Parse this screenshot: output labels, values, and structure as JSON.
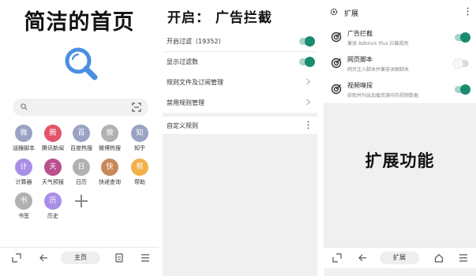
{
  "panel1": {
    "headline": "简洁的首页",
    "logo_icon": "magnifier-logo-icon",
    "search": {
      "placeholder": "",
      "search_icon": "search-icon",
      "scan_icon": "scan-icon"
    },
    "tiles": [
      {
        "glyph": "微",
        "label": "油猴脚本",
        "color": "#9aa3c4"
      },
      {
        "glyph": "腾",
        "label": "腾讯新闻",
        "color": "#e4536a"
      },
      {
        "glyph": "百",
        "label": "百度热搜",
        "color": "#9aa3c4"
      },
      {
        "glyph": "微",
        "label": "微博热搜",
        "color": "#b1b1b1"
      },
      {
        "glyph": "知",
        "label": "知乎",
        "color": "#9aa3c4"
      },
      {
        "glyph": "计",
        "label": "计算器",
        "color": "#a98ee6"
      },
      {
        "glyph": "天",
        "label": "天气预报",
        "color": "#b8508e"
      },
      {
        "glyph": "日",
        "label": "日历",
        "color": "#b1b1b1"
      },
      {
        "glyph": "快",
        "label": "快递查询",
        "color": "#c9885a"
      },
      {
        "glyph": "帮",
        "label": "帮助",
        "color": "#f0b04a"
      },
      {
        "glyph": "书",
        "label": "书签",
        "color": "#b1b1b1"
      },
      {
        "glyph": "历",
        "label": "历史",
        "color": "#a98ee6"
      },
      {
        "glyph": "+",
        "label": "",
        "color": ""
      }
    ],
    "bottombar": {
      "home_label": "主页"
    }
  },
  "panel2": {
    "title": "开启：  广告拦截",
    "rows": [
      {
        "label": "开启过滤（19352）",
        "control": "toggle-on"
      },
      {
        "label": "显示过滤数",
        "control": "toggle-on"
      },
      {
        "label": "规则文件及订阅管理",
        "control": "chevron"
      },
      {
        "label": "禁用规则管理",
        "control": "chevron"
      },
      {
        "label": "自定义规则",
        "control": "kebab"
      }
    ]
  },
  "panel3": {
    "header_title": "扩展",
    "extensions": [
      {
        "name": "广告拦截",
        "desc": "兼容 Adblock Plus 拦截规则",
        "enabled": true
      },
      {
        "name": "网页脚本",
        "desc": "网页注入脚本并兼容油猴脚本",
        "enabled": false
      },
      {
        "name": "视频嗅探",
        "desc": "获取并列出加载资源中的视频数据",
        "enabled": true
      }
    ],
    "headline": "扩展功能",
    "bottombar": {
      "pill_label": "扩展"
    }
  },
  "colors": {
    "accent_green": "#1a8a70",
    "logo_blue": "#4a8fe0"
  }
}
